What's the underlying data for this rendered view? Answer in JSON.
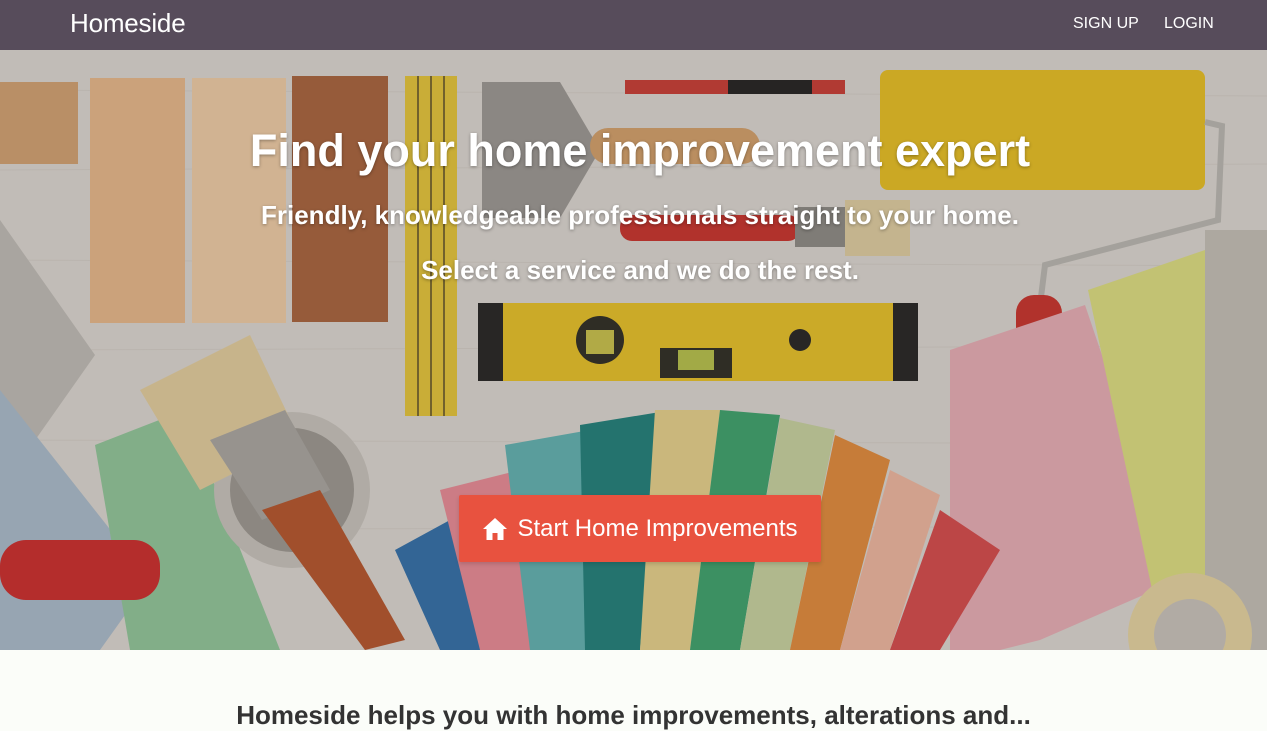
{
  "navbar": {
    "brand": "Homeside",
    "links": [
      {
        "label": "SIGN UP"
      },
      {
        "label": "LOGIN"
      }
    ]
  },
  "hero": {
    "title": "Find your home improvement expert",
    "subtitle_1": "Friendly, knowledgeable professionals straight to your home.",
    "subtitle_2": "Select a service and we do the rest.",
    "cta": {
      "label": "Start Home Improvements",
      "icon": "home-icon"
    }
  },
  "section": {
    "heading_partial": "Homeside helps you with home improvements, alterations and..."
  },
  "colors": {
    "navbar_bg": "#574c5b",
    "cta_bg": "#e8523f",
    "page_bg": "#fbfdf9"
  }
}
